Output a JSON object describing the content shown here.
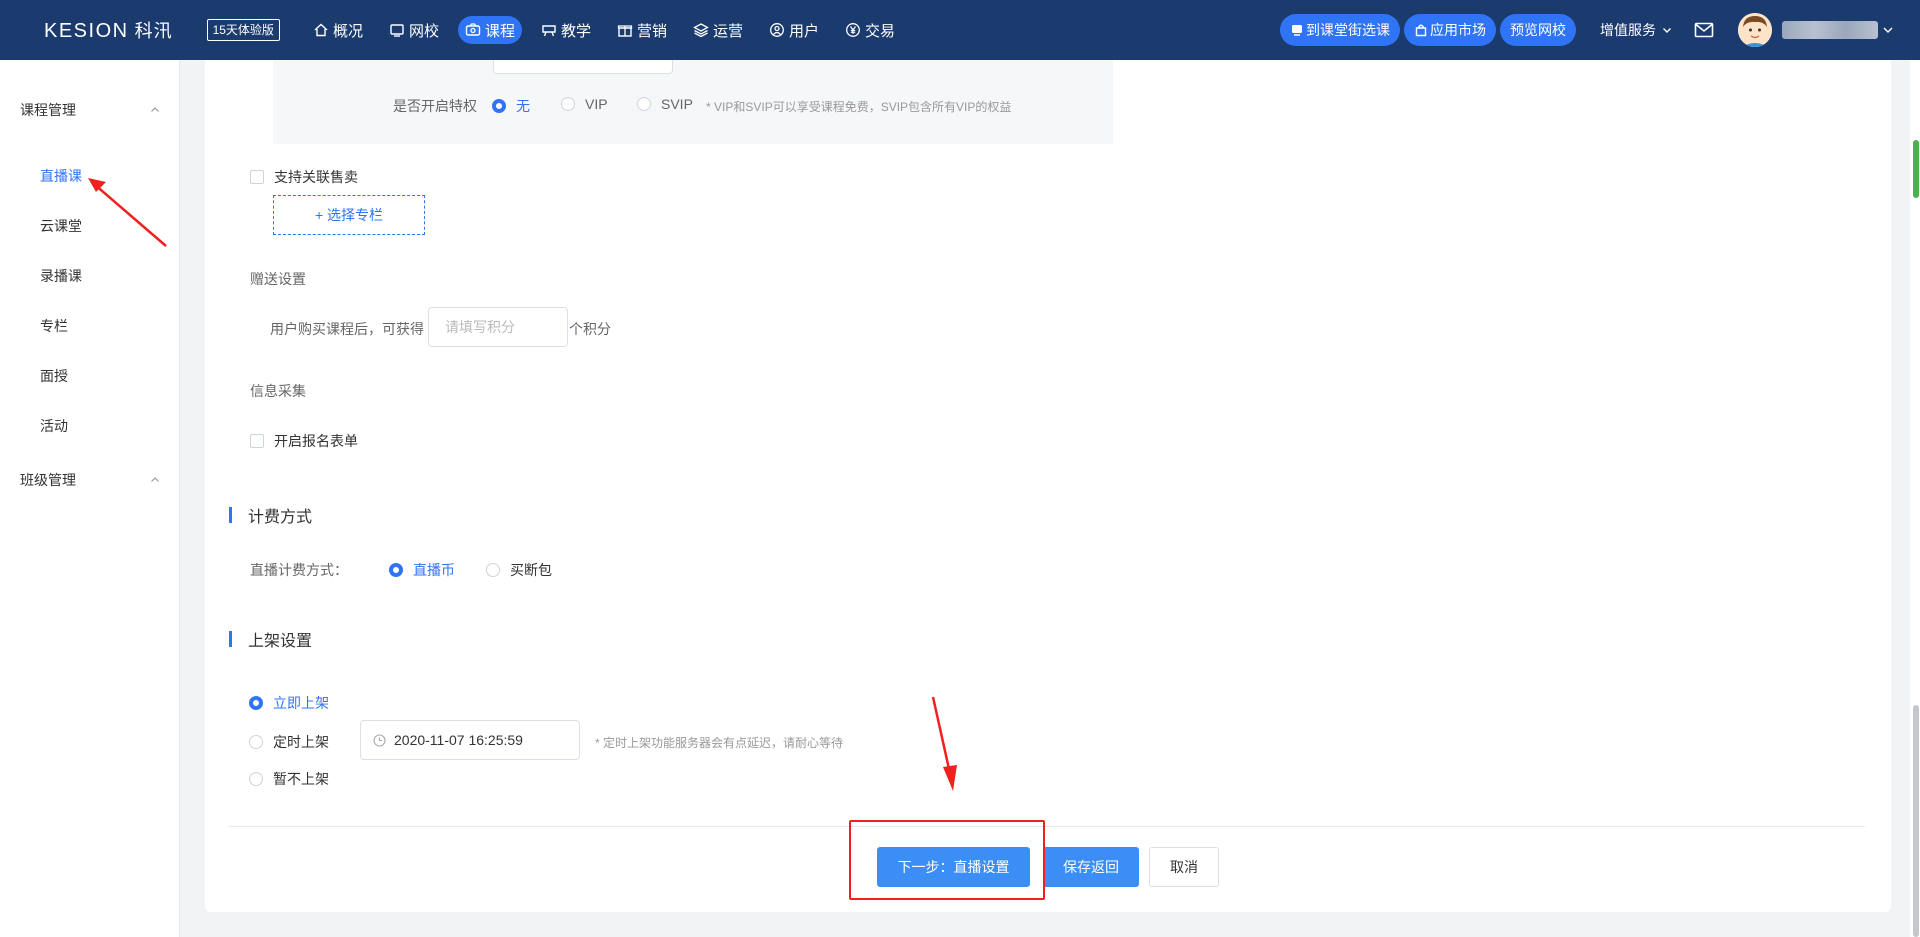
{
  "header": {
    "logo_en": "KESION",
    "logo_cn": "科汛",
    "trial_badge": "15天体验版",
    "nav": [
      {
        "label": "概况",
        "icon": "home-icon"
      },
      {
        "label": "网校",
        "icon": "school-icon"
      },
      {
        "label": "课程",
        "icon": "course-icon",
        "active": true
      },
      {
        "label": "教学",
        "icon": "teach-icon"
      },
      {
        "label": "营销",
        "icon": "gift-icon"
      },
      {
        "label": "运营",
        "icon": "layers-icon"
      },
      {
        "label": "用户",
        "icon": "user-icon"
      },
      {
        "label": "交易",
        "icon": "yen-icon"
      }
    ],
    "pills": {
      "to_street": "到课堂街选课",
      "app_market": "应用市场",
      "preview": "预览网校"
    },
    "service": "增值服务"
  },
  "sidebar": {
    "group1": "课程管理",
    "items": [
      "直播课",
      "云课堂",
      "录播课",
      "专栏",
      "面授",
      "活动"
    ],
    "active_index": 0,
    "group2": "班级管理"
  },
  "form": {
    "privilege_label": "是否开启特权",
    "privilege_options": [
      "无",
      "VIP",
      "SVIP"
    ],
    "privilege_selected": "无",
    "privilege_hint": "* VIP和SVIP可以享受课程免费，SVIP包含所有VIP的权益",
    "related_sale_label": "支持关联售卖",
    "choose_column_btn": "+ 选择专栏",
    "gift_section": "赠送设置",
    "gift_prefix": "用户购买课程后，可获得",
    "gift_placeholder": "请填写积分",
    "gift_suffix": "个积分",
    "info_section": "信息采集",
    "signup_form_label": "开启报名表单",
    "billing_title": "计费方式",
    "billing_label": "直播计费方式：",
    "billing_options": [
      "直播币",
      "买断包"
    ],
    "billing_selected": "直播币",
    "shelf_title": "上架设置",
    "shelf_options": [
      "立即上架",
      "定时上架",
      "暂不上架"
    ],
    "shelf_selected": "立即上架",
    "shelf_datetime": "2020-11-07 16:25:59",
    "shelf_hint": "* 定时上架功能服务器会有点延迟，请耐心等待"
  },
  "actions": {
    "next": "下一步：直播设置",
    "save": "保存返回",
    "cancel": "取消"
  },
  "colors": {
    "nav_bg": "#1b3a6e",
    "accent": "#2f74f5",
    "highlight": "#f0201f"
  }
}
